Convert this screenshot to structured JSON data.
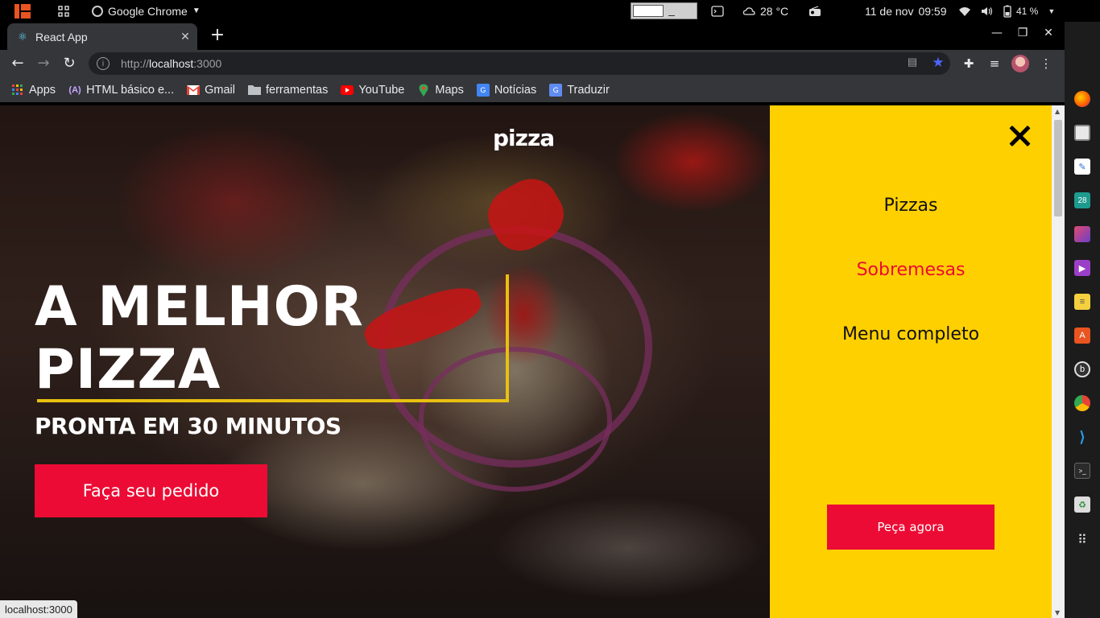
{
  "system_bar": {
    "app_name": "Google Chrome",
    "temperature": "28 °C",
    "date": "11 de nov",
    "time": "09:59",
    "battery": "41 %"
  },
  "browser": {
    "tab_title": "React App",
    "url_scheme": "http://",
    "url_host": "localhost",
    "url_port": ":3000",
    "status_url": "localhost:3000"
  },
  "bookmarks": [
    {
      "label": "Apps",
      "icon": "apps-grid-icon"
    },
    {
      "label": "HTML básico e...",
      "icon": "angular-icon"
    },
    {
      "label": "Gmail",
      "icon": "gmail-icon"
    },
    {
      "label": "ferramentas",
      "icon": "folder-icon"
    },
    {
      "label": "YouTube",
      "icon": "youtube-icon"
    },
    {
      "label": "Maps",
      "icon": "maps-pin-icon"
    },
    {
      "label": "Notícias",
      "icon": "news-icon"
    },
    {
      "label": "Traduzir",
      "icon": "translate-icon"
    }
  ],
  "page": {
    "brand": "pizza",
    "headline_line1": "A MELHOR",
    "headline_line2": "PIZZA",
    "subline": "PRONTA EM 30 MINUTOS",
    "order_button": "Faça seu pedido",
    "menu": {
      "items": [
        {
          "label": "Pizzas",
          "color": "#111111"
        },
        {
          "label": "Sobremesas",
          "color": "#ec0b34"
        },
        {
          "label": "Menu completo",
          "color": "#111111"
        }
      ],
      "cta": "Peça agora"
    }
  },
  "colors": {
    "accent_red": "#ec0b34",
    "panel_yellow": "#ffd000",
    "frame_gold": "#e8c010"
  }
}
